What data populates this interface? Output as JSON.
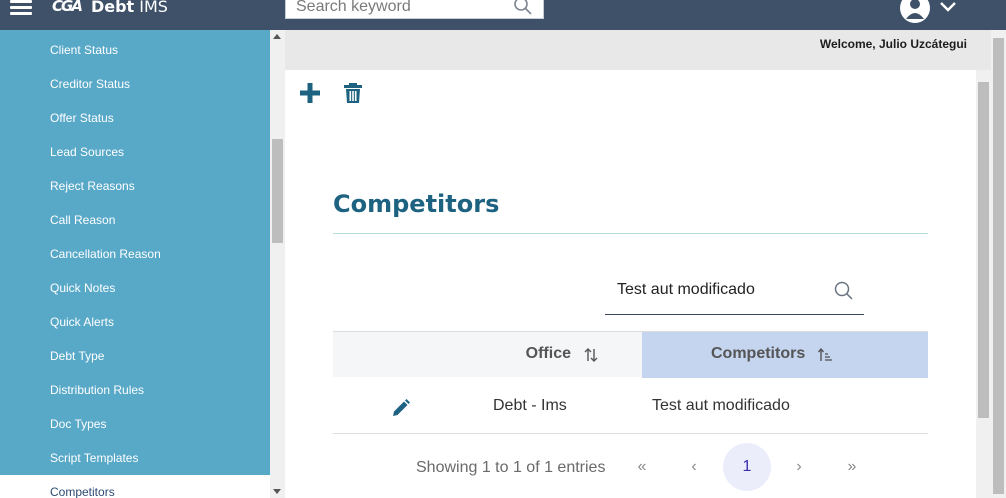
{
  "header": {
    "logo_mark": "CGA",
    "app_name_bold": "Debt",
    "app_name_rest": " IMS",
    "search": {
      "placeholder": "Search keyword",
      "value": ""
    },
    "colors": {
      "bar": "#3e5169"
    }
  },
  "sidebar": {
    "items": [
      {
        "label": "Client Status"
      },
      {
        "label": "Creditor Status"
      },
      {
        "label": "Offer Status"
      },
      {
        "label": "Lead Sources"
      },
      {
        "label": "Reject Reasons"
      },
      {
        "label": "Call Reason"
      },
      {
        "label": "Cancellation Reason"
      },
      {
        "label": "Quick Notes"
      },
      {
        "label": "Quick Alerts"
      },
      {
        "label": "Debt Type"
      },
      {
        "label": "Distribution Rules"
      },
      {
        "label": "Doc Types"
      },
      {
        "label": "Script Templates"
      },
      {
        "label": "Competitors",
        "active": true
      }
    ],
    "colors": {
      "background": "#58a8c8"
    }
  },
  "welcome": {
    "text": "Welcome, Julio Uzcátegui"
  },
  "toolbar": {
    "add_icon": "plus-icon",
    "delete_icon": "trash-icon"
  },
  "page": {
    "title": "Competitors",
    "filter": {
      "value": "Test aut modificado"
    }
  },
  "table": {
    "columns": [
      {
        "label": "Office",
        "sort_icon": "sort-both-icon"
      },
      {
        "label": "Competitors",
        "sort_icon": "sort-ascending-icon",
        "sorted": true
      }
    ],
    "rows": [
      {
        "office": "Debt - Ims",
        "competitor": "Test aut modificado",
        "action_icon": "pencil-icon"
      }
    ]
  },
  "pagination": {
    "summary": "Showing 1 to 1 of 1 entries",
    "first": "«",
    "prev": "‹",
    "current": "1",
    "next": "›",
    "last": "»"
  }
}
